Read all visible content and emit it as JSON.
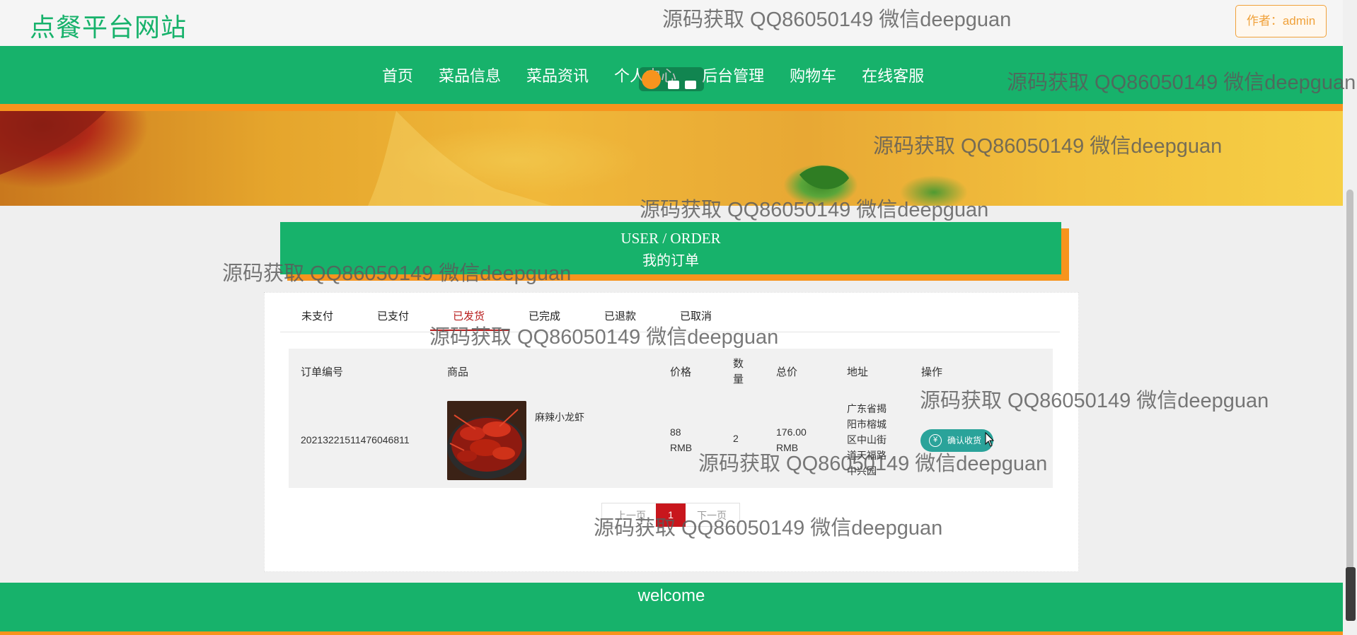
{
  "header": {
    "site_title": "点餐平台网站",
    "author_label": "作者：admin"
  },
  "nav": {
    "items": [
      "首页",
      "菜品信息",
      "菜品资讯",
      "个人中心",
      "后台管理",
      "购物车",
      "在线客服"
    ]
  },
  "section": {
    "title_en": "USER / ORDER",
    "title_cn": "我的订单"
  },
  "tabs": [
    "未支付",
    "已支付",
    "已发货",
    "已完成",
    "已退款",
    "已取消"
  ],
  "active_tab": "已发货",
  "table": {
    "headers": {
      "order_no": "订单编号",
      "product": "商品",
      "price": "价格",
      "qty": "数量",
      "total": "总价",
      "address": "地址",
      "action": "操作"
    },
    "rows": [
      {
        "order_no": "20213221511476046811",
        "product_name": "麻辣小龙虾",
        "price": "88 RMB",
        "qty": "2",
        "total": "176.00 RMB",
        "address": "广东省揭阳市榕城区中山街道天福路中兴园",
        "action_label": "确认收货"
      }
    ]
  },
  "pagination": {
    "prev": "上一页",
    "current": "1",
    "next": "下一页"
  },
  "footer": {
    "text": "welcome"
  },
  "watermark": "源码获取 QQ86050149 微信deepguan",
  "colors": {
    "brand_green": "#17b26b",
    "accent_orange": "#f7941d",
    "active_red": "#b71c1c",
    "action_teal": "#2aa39a"
  }
}
